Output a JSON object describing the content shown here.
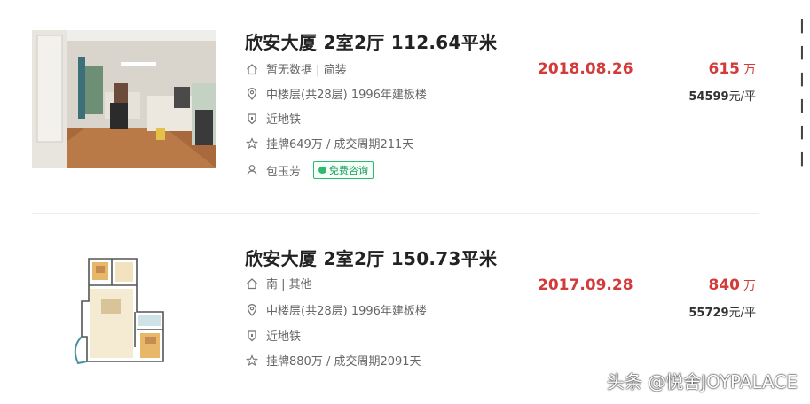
{
  "listings": [
    {
      "title": "欣安大厦 2室2厅 112.64平米",
      "house_info": "暂无数据 | 简装",
      "position_info": "中楼层(共28层) 1996年建板楼",
      "subway": "近地铁",
      "listing_info": "挂牌649万 / 成交周期211天",
      "agent": "包玉芳",
      "consult_label": "免费咨询",
      "deal_date": "2018.08.26",
      "total_price": "615",
      "price_unit": "万",
      "unit_price": "54599",
      "unit_price_suffix": "元/平"
    },
    {
      "title": "欣安大厦 2室2厅 150.73平米",
      "house_info": "南 | 其他",
      "position_info": "中楼层(共28层) 1996年建板楼",
      "subway": "近地铁",
      "listing_info": "挂牌880万 / 成交周期2091天",
      "deal_date": "2017.09.28",
      "total_price": "840",
      "price_unit": "万",
      "unit_price": "55729",
      "unit_price_suffix": "元/平"
    }
  ],
  "watermark": "头条 @悦舍JOYPALACE",
  "colors": {
    "accent": "#d33b3b",
    "consult": "#2eb872"
  }
}
